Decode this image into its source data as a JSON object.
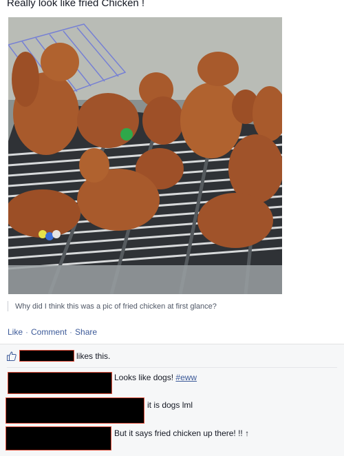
{
  "post": {
    "title": "Really look like fried Chicken !",
    "photo_description_icon": "photo",
    "caption": "Why did I think this was a pic of fried chicken at first glance?"
  },
  "actions": {
    "like": "Like",
    "comment": "Comment",
    "share": "Share",
    "separator": "·"
  },
  "likes": {
    "suffix": "likes this."
  },
  "comments": [
    {
      "text": "Looks like dogs! ",
      "hashtag": "#eww"
    },
    {
      "text": "it is dogs lml",
      "hashtag": ""
    },
    {
      "text": "But it says fried chicken up there! !! ↑",
      "hashtag": ""
    }
  ],
  "colors": {
    "link": "#3b5998",
    "redaction_border": "#e0503c",
    "ufi_background": "#f6f7f8"
  }
}
